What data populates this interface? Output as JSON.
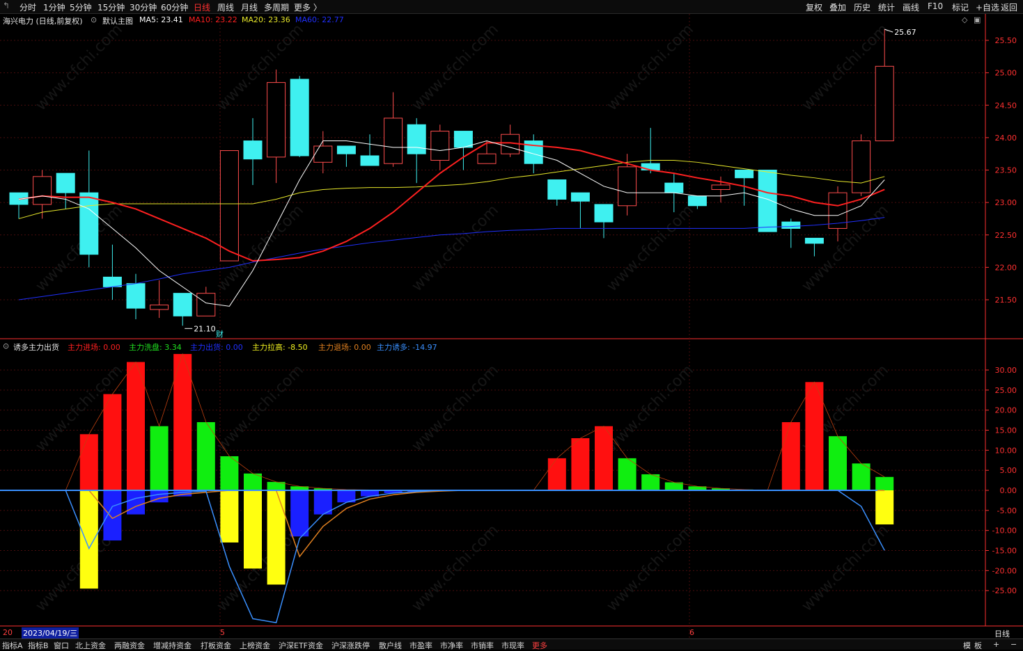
{
  "top_left_icon": "back-arrow-icon",
  "periods": [
    "分时",
    "1分钟",
    "5分钟",
    "15分钟",
    "30分钟",
    "60分钟",
    "日线",
    "周线",
    "月线",
    "多周期",
    "更多 〉"
  ],
  "active_period": "日线",
  "right_menu": [
    "复权",
    "叠加",
    "历史",
    "统计",
    "画线",
    "F10",
    "标记",
    "+自选",
    "返回"
  ],
  "main": {
    "stock": "海兴电力 (日线,前复权)",
    "template": "默认主图",
    "ma5": "MA5: 23.41",
    "ma10": "MA10: 23.22",
    "ma20": "MA20: 23.36",
    "ma60": "MA60: 22.77",
    "high_label": "25.67",
    "low_label": "21.10",
    "fin_marker": "财",
    "y_ticks": [
      "25.50",
      "25.00",
      "24.50",
      "24.00",
      "23.50",
      "23.00",
      "22.50",
      "22.00",
      "21.50"
    ]
  },
  "indicator": {
    "name": "诱多主力出货",
    "entry": "主力进场: 0.00",
    "wash": "主力洗盘: 3.34",
    "ship": "主力出货: 0.00",
    "pull": "主力拉高: -8.50",
    "exit": "主力退场: 0.00",
    "lure": "主力诱多: -14.97",
    "y_ticks": [
      "30.00",
      "25.00",
      "20.00",
      "15.00",
      "10.00",
      "5.00",
      "0.00",
      "-5.00",
      "-10.00",
      "-15.00",
      "-20.00",
      "-25.00"
    ]
  },
  "date_axis": {
    "cursor_date": "2023/04/19/三",
    "month_5": "5",
    "month_6": "6",
    "prefix": "20"
  },
  "bottom_tabs": [
    "指标A",
    "指标B",
    "窗口",
    "北上资金",
    "两融资金",
    "增减持资金",
    "打板资金",
    "上榜资金",
    "沪深ETF资金",
    "沪深涨跌停",
    "散户线",
    "市盈率",
    "市净率",
    "市销率",
    "市现率",
    "更多"
  ],
  "bottom_right": [
    "模",
    "板",
    "日线",
    "+",
    "−"
  ],
  "watermark": "www.cfchi.com",
  "colors": {
    "up": "#ff4d4d",
    "down": "#3ff0f0",
    "ma5": "#ffffff",
    "ma10": "#ff2020",
    "ma20": "#e8e82a",
    "ma60": "#2030ff",
    "axis": "#ff3030"
  },
  "chart_data": [
    {
      "type": "candlestick",
      "title": "海兴电力 (日线,前复权)",
      "ylim": [
        21.0,
        25.75
      ],
      "candles": [
        {
          "o": 23.15,
          "c": 22.97,
          "h": 23.15,
          "l": 22.75
        },
        {
          "o": 22.97,
          "c": 23.4,
          "h": 23.5,
          "l": 22.75
        },
        {
          "o": 23.45,
          "c": 23.15,
          "h": 23.45,
          "l": 22.9
        },
        {
          "o": 23.15,
          "c": 22.2,
          "h": 23.8,
          "l": 22.0
        },
        {
          "o": 21.85,
          "c": 21.7,
          "h": 22.35,
          "l": 21.5
        },
        {
          "o": 21.75,
          "c": 21.37,
          "h": 21.9,
          "l": 21.2
        },
        {
          "o": 21.35,
          "c": 21.42,
          "h": 21.8,
          "l": 21.22
        },
        {
          "o": 21.6,
          "c": 21.25,
          "h": 21.6,
          "l": 21.1
        },
        {
          "o": 21.25,
          "c": 21.6,
          "h": 21.7,
          "l": 21.25
        },
        {
          "o": 22.1,
          "c": 23.8,
          "h": 23.8,
          "l": 22.1
        },
        {
          "o": 23.95,
          "c": 23.67,
          "h": 24.3,
          "l": 23.27
        },
        {
          "o": 23.7,
          "c": 24.85,
          "h": 25.05,
          "l": 23.3
        },
        {
          "o": 24.9,
          "c": 23.72,
          "h": 24.95,
          "l": 23.7
        },
        {
          "o": 23.62,
          "c": 23.87,
          "h": 24.1,
          "l": 23.45
        },
        {
          "o": 23.87,
          "c": 23.75,
          "h": 23.87,
          "l": 23.55
        },
        {
          "o": 23.72,
          "c": 23.57,
          "h": 24.05,
          "l": 23.57
        },
        {
          "o": 23.6,
          "c": 24.3,
          "h": 24.7,
          "l": 23.55
        },
        {
          "o": 24.2,
          "c": 23.75,
          "h": 24.3,
          "l": 23.3
        },
        {
          "o": 23.65,
          "c": 24.1,
          "h": 24.2,
          "l": 23.5
        },
        {
          "o": 24.1,
          "c": 23.85,
          "h": 24.1,
          "l": 23.5
        },
        {
          "o": 23.6,
          "c": 23.75,
          "h": 23.95,
          "l": 23.6
        },
        {
          "o": 23.75,
          "c": 24.05,
          "h": 24.2,
          "l": 23.7
        },
        {
          "o": 23.95,
          "c": 23.6,
          "h": 24.05,
          "l": 23.45
        },
        {
          "o": 23.35,
          "c": 23.05,
          "h": 23.35,
          "l": 22.95
        },
        {
          "o": 23.15,
          "c": 23.02,
          "h": 23.15,
          "l": 22.6
        },
        {
          "o": 22.97,
          "c": 22.7,
          "h": 22.97,
          "l": 22.45
        },
        {
          "o": 22.95,
          "c": 23.55,
          "h": 23.75,
          "l": 22.8
        },
        {
          "o": 23.6,
          "c": 23.5,
          "h": 24.15,
          "l": 23.45
        },
        {
          "o": 23.3,
          "c": 23.15,
          "h": 23.45,
          "l": 22.85
        },
        {
          "o": 23.1,
          "c": 22.95,
          "h": 23.1,
          "l": 22.9
        },
        {
          "o": 23.2,
          "c": 23.27,
          "h": 23.4,
          "l": 23.0
        },
        {
          "o": 23.5,
          "c": 23.38,
          "h": 23.5,
          "l": 22.95
        },
        {
          "o": 23.5,
          "c": 22.55,
          "h": 23.5,
          "l": 22.55
        },
        {
          "o": 22.7,
          "c": 22.6,
          "h": 22.75,
          "l": 22.3
        },
        {
          "o": 22.45,
          "c": 22.37,
          "h": 22.45,
          "l": 22.17
        },
        {
          "o": 22.6,
          "c": 23.15,
          "h": 23.25,
          "l": 22.4
        },
        {
          "o": 23.15,
          "c": 23.95,
          "h": 24.05,
          "l": 23.1
        },
        {
          "o": 23.95,
          "c": 25.1,
          "h": 25.67,
          "l": 23.95
        }
      ],
      "ma5": [
        23.05,
        23.1,
        23.05,
        22.9,
        22.6,
        22.3,
        21.95,
        21.7,
        21.45,
        21.4,
        21.95,
        22.65,
        23.35,
        23.95,
        23.95,
        23.9,
        23.85,
        23.85,
        23.8,
        23.85,
        23.95,
        23.85,
        23.75,
        23.65,
        23.45,
        23.25,
        23.15,
        23.15,
        23.15,
        23.1,
        23.1,
        23.15,
        23.05,
        22.9,
        22.8,
        22.8,
        22.95,
        23.35
      ],
      "ma10": [
        23.05,
        23.1,
        23.08,
        23.08,
        23.0,
        22.9,
        22.75,
        22.6,
        22.45,
        22.25,
        22.1,
        22.12,
        22.15,
        22.25,
        22.4,
        22.6,
        22.85,
        23.15,
        23.45,
        23.7,
        23.92,
        23.92,
        23.88,
        23.85,
        23.8,
        23.7,
        23.6,
        23.5,
        23.45,
        23.38,
        23.32,
        23.25,
        23.15,
        23.1,
        23.0,
        22.95,
        23.05,
        23.2
      ],
      "ma20": [
        22.75,
        22.85,
        22.9,
        22.95,
        22.98,
        22.98,
        22.98,
        22.98,
        22.98,
        22.98,
        22.98,
        23.05,
        23.15,
        23.2,
        23.22,
        23.23,
        23.23,
        23.24,
        23.26,
        23.28,
        23.32,
        23.38,
        23.42,
        23.47,
        23.52,
        23.57,
        23.62,
        23.65,
        23.65,
        23.62,
        23.57,
        23.52,
        23.47,
        23.42,
        23.38,
        23.33,
        23.3,
        23.4
      ],
      "ma60": [
        21.5,
        21.55,
        21.6,
        21.65,
        21.7,
        21.75,
        21.82,
        21.9,
        21.95,
        22.0,
        22.08,
        22.15,
        22.22,
        22.28,
        22.33,
        22.38,
        22.42,
        22.46,
        22.5,
        22.52,
        22.55,
        22.57,
        22.58,
        22.6,
        22.6,
        22.6,
        22.6,
        22.6,
        22.6,
        22.6,
        22.6,
        22.6,
        22.62,
        22.63,
        22.65,
        22.68,
        22.72,
        22.77
      ]
    },
    {
      "type": "bar",
      "title": "诱多主力出货",
      "ylim": [
        -30,
        33
      ],
      "series": [
        {
          "name": "主力进场",
          "values": [
            0,
            0,
            0,
            14,
            24,
            32,
            0,
            34,
            0,
            0,
            0,
            0,
            0,
            0,
            0,
            0,
            0,
            0,
            0,
            0,
            0,
            0,
            0,
            8,
            13,
            16,
            0,
            0,
            0,
            0,
            0,
            0,
            0,
            17,
            27,
            0,
            0,
            0
          ]
        },
        {
          "name": "主力洗盘",
          "values": [
            0,
            0,
            0,
            0,
            0,
            0,
            16,
            0,
            17,
            8.5,
            4.2,
            2.1,
            1.0,
            0.5,
            0.2,
            0.1,
            0,
            0,
            0,
            0,
            0,
            0,
            0,
            0,
            0,
            0,
            8,
            4,
            2,
            1,
            0.5,
            0.2,
            0,
            0,
            0,
            13.5,
            6.7,
            3.34
          ]
        },
        {
          "name": "主力出货",
          "values": [
            0,
            0,
            0,
            0,
            -12.5,
            -6,
            -3,
            -1.5,
            0,
            0,
            0,
            0,
            -11.5,
            -6,
            -3,
            -1.5,
            -0.7,
            -0.3,
            -0.1,
            0,
            0,
            0,
            0,
            0,
            0,
            0,
            0,
            0,
            0,
            0,
            0,
            0,
            0,
            0,
            0,
            0,
            0,
            0
          ]
        },
        {
          "name": "主力拉高",
          "values": [
            0,
            0,
            0,
            -24.5,
            0,
            0,
            0,
            0,
            0,
            -13,
            -19.5,
            -23.5,
            0,
            0,
            0,
            0,
            0,
            0,
            0,
            0,
            0,
            0,
            0,
            0,
            0,
            0,
            0,
            0,
            0,
            0,
            0,
            0,
            0,
            0,
            0,
            0,
            0,
            -8.5
          ]
        },
        {
          "name": "主力退场",
          "values": [
            0,
            0,
            0,
            0,
            -7,
            -4,
            -2,
            -1,
            -0.5,
            0,
            0,
            0,
            -16.5,
            -9,
            -4.5,
            -2.2,
            -1.1,
            -0.5,
            -0.2,
            0,
            0,
            0,
            0,
            0,
            0,
            0,
            0,
            0,
            0,
            0,
            0,
            0,
            0,
            0,
            0,
            0,
            0,
            0
          ]
        },
        {
          "name": "主力诱多",
          "values": [
            0,
            0,
            0,
            -14.5,
            -4,
            -2,
            -1,
            -0.5,
            -0.2,
            -19,
            -32,
            -33,
            -12,
            -6,
            -3,
            -1.5,
            -0.7,
            -0.3,
            0,
            0,
            0,
            0,
            0,
            0,
            0,
            0,
            0,
            0,
            0,
            0,
            0,
            0,
            0,
            0,
            0,
            0,
            -4,
            -14.97
          ]
        }
      ]
    }
  ]
}
